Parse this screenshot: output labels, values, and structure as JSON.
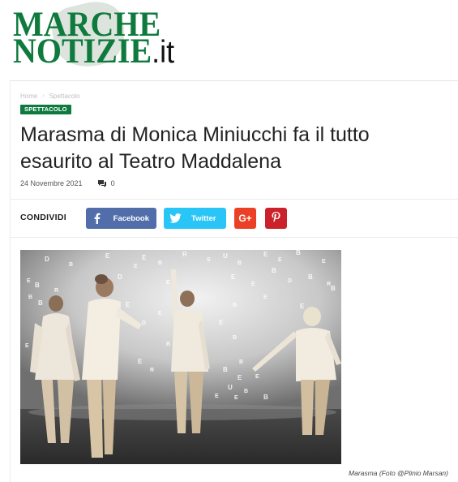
{
  "logo": {
    "line1": "MARCHE",
    "line2": "NOTIZIE",
    "suffix": ".it",
    "brand_color": "#0e7a3d"
  },
  "breadcrumb": {
    "home": "Home",
    "current": "Spettacolo"
  },
  "category": {
    "label": "SPETTACOLO",
    "color": "#0e7a3d"
  },
  "article": {
    "title": "Marasma di Monica Miniucchi fa il tutto esaurito al Teatro Maddalena",
    "date": "24 Novembre 2021",
    "comments": "0"
  },
  "share": {
    "label": "CONDIVIDI",
    "buttons": [
      {
        "name": "Facebook",
        "label": "Facebook",
        "icon": "facebook-icon",
        "color": "#516eab"
      },
      {
        "name": "Twitter",
        "label": "Twitter",
        "icon": "twitter-icon",
        "color": "#29c5f6"
      },
      {
        "name": "Google+",
        "label": "G+",
        "icon": "google-plus-icon",
        "color": "#eb4026"
      },
      {
        "name": "Pinterest",
        "label": "",
        "icon": "pinterest-icon",
        "color": "#ca212a"
      }
    ]
  },
  "photo": {
    "caption": "Marasma (Foto @Plinio Marsan)"
  }
}
